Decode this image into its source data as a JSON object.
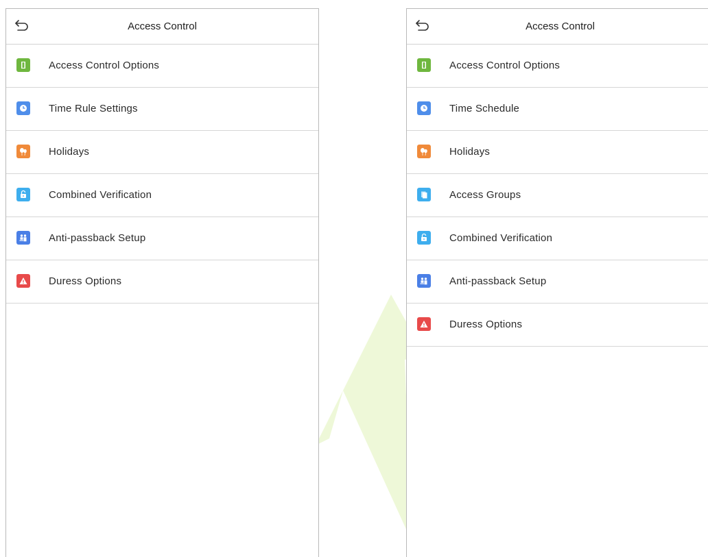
{
  "screens": [
    {
      "title": "Access Control",
      "items": [
        {
          "label": "Access Control Options",
          "icon": "door-icon",
          "color": "#6fb73f"
        },
        {
          "label": "Time Rule Settings",
          "icon": "clock-icon",
          "color": "#4f8eea"
        },
        {
          "label": "Holidays",
          "icon": "balloon-icon",
          "color": "#f08a3a"
        },
        {
          "label": "Combined Verification",
          "icon": "unlock-icon",
          "color": "#3eaeee"
        },
        {
          "label": "Anti-passback Setup",
          "icon": "people-icon",
          "color": "#4a7fe6"
        },
        {
          "label": "Duress Options",
          "icon": "warning-icon",
          "color": "#e84a4a"
        }
      ]
    },
    {
      "title": "Access Control",
      "items": [
        {
          "label": "Access Control Options",
          "icon": "door-icon",
          "color": "#6fb73f"
        },
        {
          "label": "Time Schedule",
          "icon": "clock-icon",
          "color": "#4f8eea"
        },
        {
          "label": "Holidays",
          "icon": "balloon-icon",
          "color": "#f08a3a"
        },
        {
          "label": "Access Groups",
          "icon": "group-doc-icon",
          "color": "#3eaeee"
        },
        {
          "label": "Combined Verification",
          "icon": "unlock-icon",
          "color": "#3eaeee"
        },
        {
          "label": "Anti-passback Setup",
          "icon": "people-icon",
          "color": "#4a7fe6"
        },
        {
          "label": "Duress Options",
          "icon": "warning-icon",
          "color": "#e84a4a"
        }
      ]
    }
  ]
}
